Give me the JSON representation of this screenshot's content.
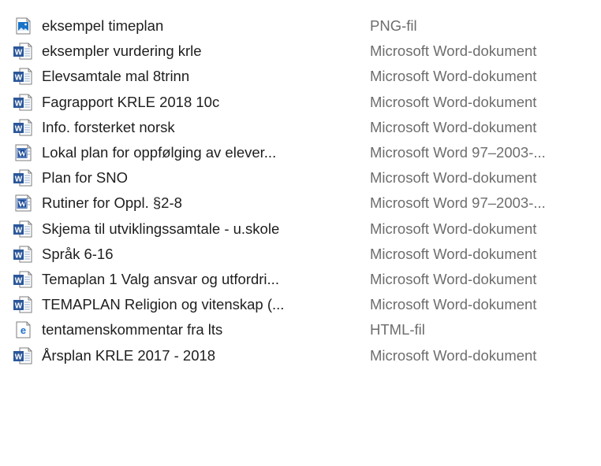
{
  "files": [
    {
      "name": "eksempel timeplan",
      "type": "PNG-fil",
      "icon": "image-file-icon"
    },
    {
      "name": "eksempler vurdering krle",
      "type": "Microsoft Word-dokument",
      "icon": "word-docx-icon"
    },
    {
      "name": "Elevsamtale mal 8trinn",
      "type": "Microsoft Word-dokument",
      "icon": "word-docx-icon"
    },
    {
      "name": "Fagrapport KRLE 2018 10c",
      "type": "Microsoft Word-dokument",
      "icon": "word-docx-icon"
    },
    {
      "name": "Info. forsterket norsk",
      "type": "Microsoft Word-dokument",
      "icon": "word-docx-icon"
    },
    {
      "name": "Lokal plan for oppfølging av elever...",
      "type": "Microsoft Word 97–2003-...",
      "icon": "word-doc-97-icon"
    },
    {
      "name": "Plan for SNO",
      "type": "Microsoft Word-dokument",
      "icon": "word-docx-icon"
    },
    {
      "name": "Rutiner for Oppl. §2-8",
      "type": "Microsoft Word 97–2003-...",
      "icon": "word-doc-97-icon"
    },
    {
      "name": "Skjema til utviklingssamtale - u.skole",
      "type": "Microsoft Word-dokument",
      "icon": "word-docx-icon"
    },
    {
      "name": "Språk 6-16",
      "type": "Microsoft Word-dokument",
      "icon": "word-docx-icon"
    },
    {
      "name": "Temaplan 1 Valg ansvar og utfordri...",
      "type": "Microsoft Word-dokument",
      "icon": "word-docx-icon"
    },
    {
      "name": "TEMAPLAN Religion og vitenskap (...",
      "type": "Microsoft Word-dokument",
      "icon": "word-docx-icon"
    },
    {
      "name": "tentamenskommentar fra lts",
      "type": "HTML-fil",
      "icon": "html-file-icon"
    },
    {
      "name": "Årsplan KRLE 2017 - 2018",
      "type": "Microsoft Word-dokument",
      "icon": "word-docx-icon"
    }
  ],
  "colors": {
    "name_text": "#1e1e1e",
    "type_text": "#6d6d6d",
    "word_blue": "#2b579a",
    "word_97_blue": "#1f4e9a",
    "image_blue": "#1a73c8",
    "html_blue": "#1e6fc8",
    "hover": "#e5f3ff"
  }
}
